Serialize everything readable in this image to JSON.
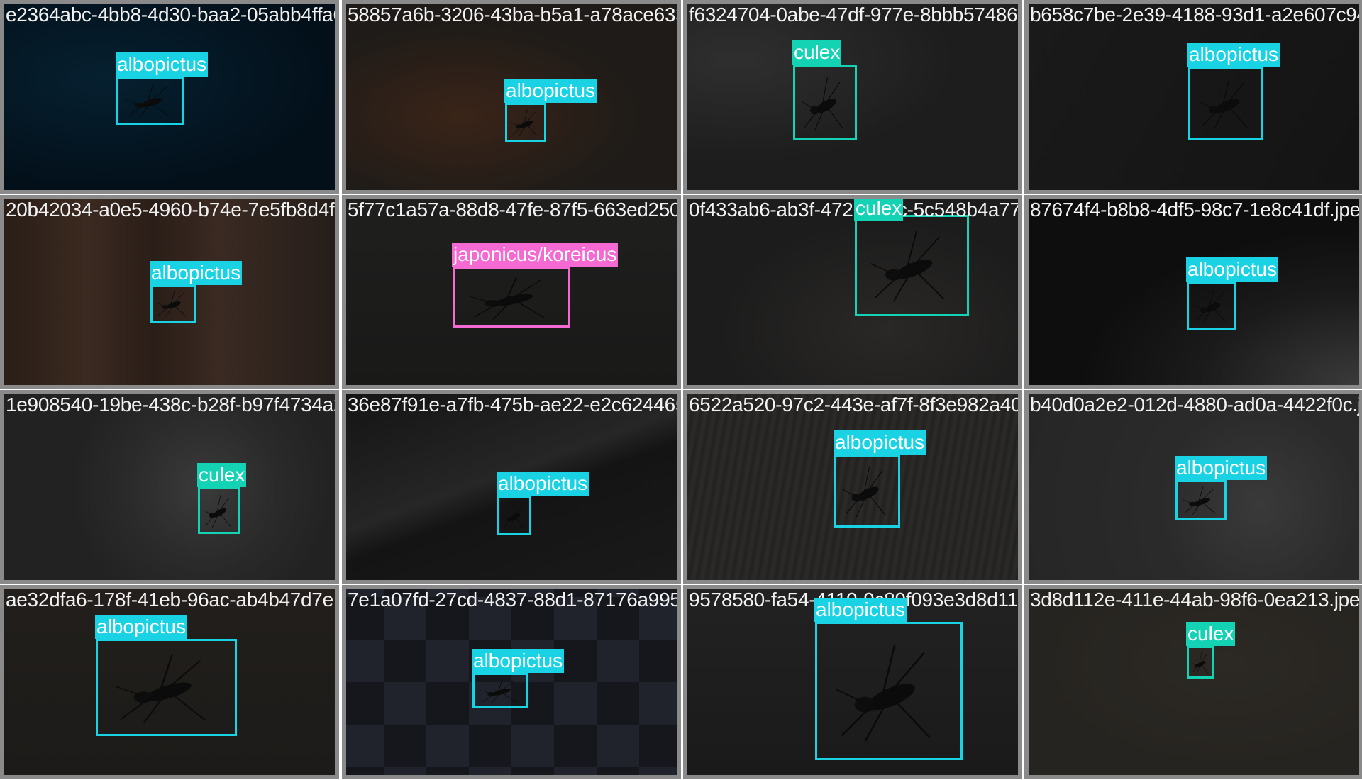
{
  "classes": {
    "albopictus": {
      "color": "#19d3e4"
    },
    "culex": {
      "color": "#14d2b4"
    },
    "japonicus/koreicus": {
      "color": "#f56ad2"
    }
  },
  "tiles": [
    {
      "filename": "e2364abc-4bb8-4d30-baa2-05abb4ffa67402.jpeg",
      "bg": "#03101a",
      "dets": [
        {
          "label": "albopictus"
        }
      ]
    },
    {
      "filename": "58857a6b-3206-43ba-b5a1-a78ace63349704.jpeg",
      "bg": "#1e1b18",
      "dets": [
        {
          "label": "albopictus"
        }
      ]
    },
    {
      "filename": "f6324704-0abe-47df-977e-8bbb574866f5738.jpeg",
      "bg": "#1d1d1d",
      "dets": [
        {
          "label": "culex"
        }
      ]
    },
    {
      "filename": "b658c7be-2e39-4188-93d1-a2e607c94.jpeg",
      "bg": "#171717",
      "dets": [
        {
          "label": "albopictus"
        }
      ]
    },
    {
      "filename": "20b42034-a0e5-4960-b74e-7e5fb8d4f9765f.jpeg",
      "bg": "#261e1a",
      "dets": [
        {
          "label": "albopictus"
        }
      ]
    },
    {
      "filename": "5f77c1a57a-88d8-47fe-87f5-663ed25012357.jpeg",
      "bg": "#1c1c1b",
      "dets": [
        {
          "label": "japonicus/koreicus"
        }
      ]
    },
    {
      "filename": "0f433ab6-ab3f-4726-9f5c-5c548b4a77e3744.jpeg",
      "bg": "#1c1c1c",
      "dets": [
        {
          "label": "culex"
        }
      ]
    },
    {
      "filename": "87674f4-b8b8-4df5-98c7-1e8c41df.jpeg",
      "bg": "#0e0e0e",
      "dets": [
        {
          "label": "albopictus"
        }
      ]
    },
    {
      "filename": "1e908540-19be-438c-b28f-b97f4734a2876f91.jpeg",
      "bg": "#222222",
      "dets": [
        {
          "label": "culex"
        }
      ]
    },
    {
      "filename": "36e87f91e-a7fb-475b-ae22-e2c6244652a520.jpeg",
      "bg": "#1a1a1a",
      "dets": [
        {
          "label": "albopictus"
        }
      ]
    },
    {
      "filename": "6522a520-97c2-443e-af7f-8f3e982a40d0a.jpeg",
      "bg": "#242322",
      "dets": [
        {
          "label": "albopictus"
        }
      ]
    },
    {
      "filename": "b40d0a2e2-012d-4880-ad0a-4422f0c.jpeg",
      "bg": "#262626",
      "dets": [
        {
          "label": "albopictus"
        }
      ]
    },
    {
      "filename": "ae32dfa6-178f-41eb-96ac-ab4b47d7e1a07fd.jpeg",
      "bg": "#1c1b19",
      "dets": [
        {
          "label": "albopictus"
        }
      ]
    },
    {
      "filename": "7e1a07fd-27cd-4837-88d1-87176a9957d8580.jpeg",
      "bg": "#1b1c20",
      "dets": [
        {
          "label": "albopictus"
        }
      ]
    },
    {
      "filename": "9578580-fa54-4110-9c89f093e3d8d112.jpeg",
      "bg": "#1e1e1e",
      "dets": [
        {
          "label": "albopictus"
        }
      ]
    },
    {
      "filename": "3d8d112e-411e-44ab-98f6-0ea213.jpeg",
      "bg": "#262420",
      "dets": [
        {
          "label": "culex"
        }
      ]
    }
  ]
}
